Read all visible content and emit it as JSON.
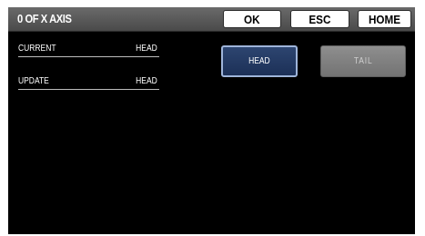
{
  "header": {
    "title": "0 OF X AXIS",
    "buttons": {
      "ok": "OK",
      "esc": "ESC",
      "home": "HOME"
    }
  },
  "fields": {
    "current": {
      "label": "CURRENT",
      "value": "HEAD"
    },
    "update": {
      "label": "UPDATE",
      "value": "HEAD"
    }
  },
  "options": {
    "head": {
      "label": "HEAD",
      "selected": true
    },
    "tail": {
      "label": "TAIL",
      "selected": false
    }
  },
  "colors": {
    "background": "#000000",
    "header": "#555555",
    "selected_option": "#1c3057",
    "unselected_option": "#808080"
  }
}
